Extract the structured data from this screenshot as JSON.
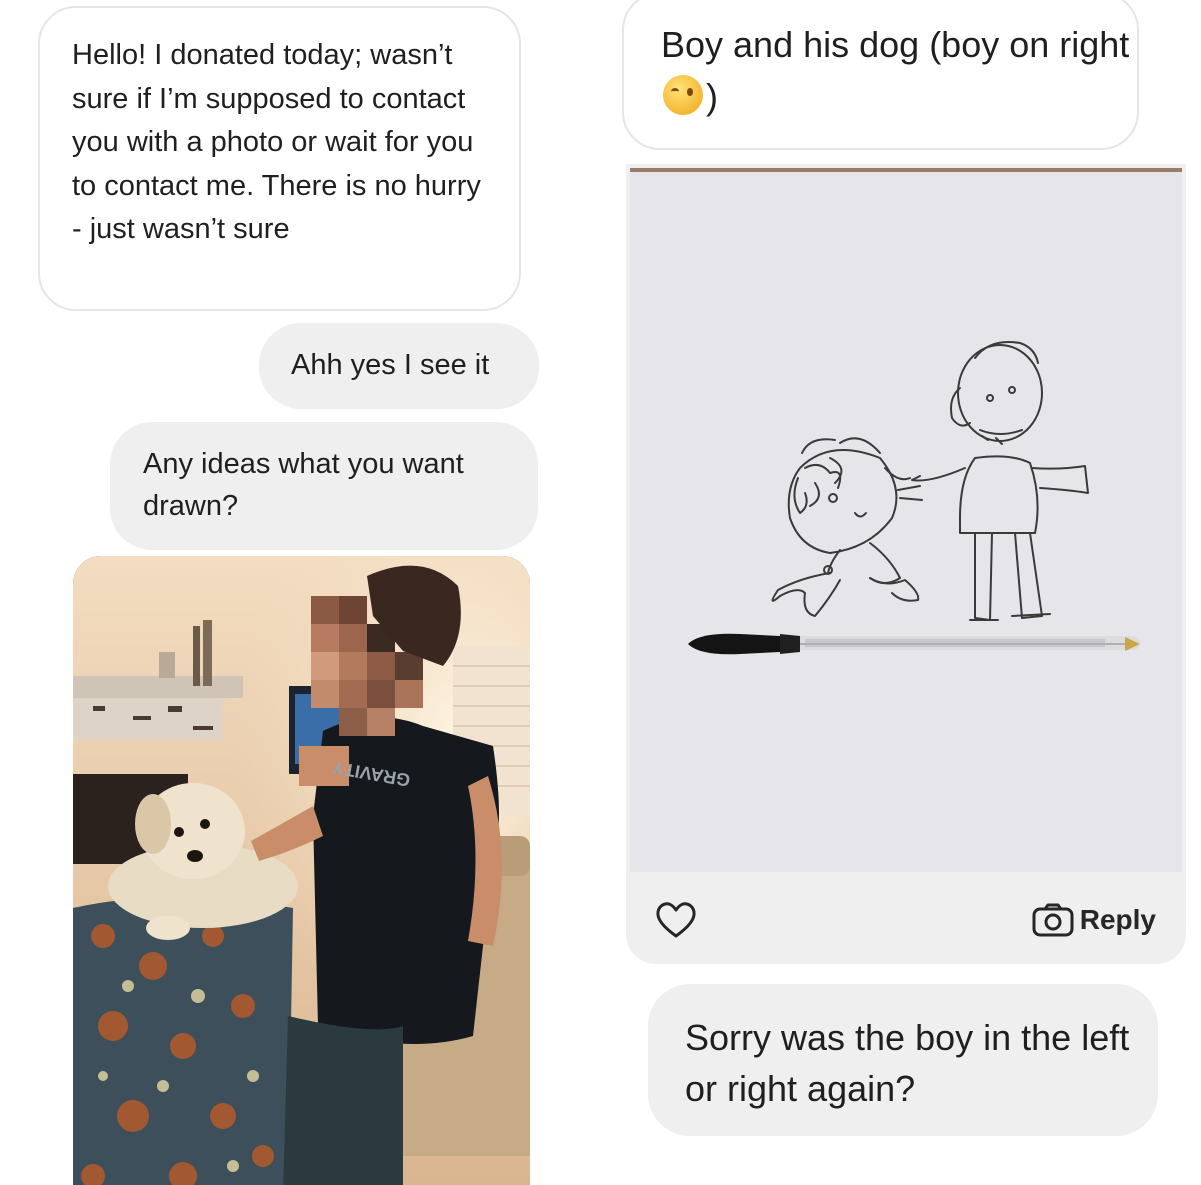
{
  "left_column": {
    "incoming_message_1": "Hello! I donated today; wasn’t sure if I’m supposed to contact you with a photo or wait for you to contact me. There is no hurry - just wasn’t sure",
    "outgoing_message_1": "Ahh yes I see it",
    "outgoing_message_2": "Any ideas what you want drawn?",
    "photo": {
      "subject": "boy-and-dog-photo",
      "shirt_text": "GRAVITY"
    }
  },
  "right_column": {
    "incoming_message_2_prefix": "Boy and his dog (boy on right",
    "incoming_message_2_suffix": ")",
    "emoji": "winking-face",
    "shared_image": {
      "subject": "pen-drawing-boy-and-dog"
    },
    "reply_label": "Reply",
    "outgoing_message_3": "Sorry was the boy in the left or right again?"
  },
  "colors": {
    "bubble_gray": "#efefef",
    "bubble_outline": "#e5e5e5",
    "text": "#1f1f1f"
  }
}
